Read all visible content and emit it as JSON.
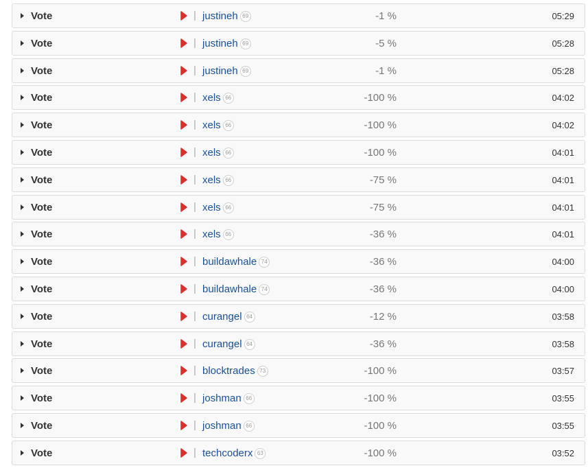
{
  "colors": {
    "link": "#1a5099",
    "play_icon": "#d9302c",
    "row_background": "#f9f9f9",
    "row_border": "#dcdcdc"
  },
  "icons": {
    "expand": "caret-right-icon",
    "media": "play-icon",
    "separator": "|"
  },
  "rows": [
    {
      "op": "Vote",
      "voter": "justineh",
      "rep": "69",
      "weight": "-1 %",
      "time": "05:29"
    },
    {
      "op": "Vote",
      "voter": "justineh",
      "rep": "69",
      "weight": "-5 %",
      "time": "05:28"
    },
    {
      "op": "Vote",
      "voter": "justineh",
      "rep": "69",
      "weight": "-1 %",
      "time": "05:28"
    },
    {
      "op": "Vote",
      "voter": "xels",
      "rep": "66",
      "weight": "-100 %",
      "time": "04:02"
    },
    {
      "op": "Vote",
      "voter": "xels",
      "rep": "66",
      "weight": "-100 %",
      "time": "04:02"
    },
    {
      "op": "Vote",
      "voter": "xels",
      "rep": "66",
      "weight": "-100 %",
      "time": "04:01"
    },
    {
      "op": "Vote",
      "voter": "xels",
      "rep": "66",
      "weight": "-75 %",
      "time": "04:01"
    },
    {
      "op": "Vote",
      "voter": "xels",
      "rep": "66",
      "weight": "-75 %",
      "time": "04:01"
    },
    {
      "op": "Vote",
      "voter": "xels",
      "rep": "66",
      "weight": "-36 %",
      "time": "04:01"
    },
    {
      "op": "Vote",
      "voter": "buildawhale",
      "rep": "74",
      "weight": "-36 %",
      "time": "04:00"
    },
    {
      "op": "Vote",
      "voter": "buildawhale",
      "rep": "74",
      "weight": "-36 %",
      "time": "04:00"
    },
    {
      "op": "Vote",
      "voter": "curangel",
      "rep": "64",
      "weight": "-12 %",
      "time": "03:58"
    },
    {
      "op": "Vote",
      "voter": "curangel",
      "rep": "64",
      "weight": "-36 %",
      "time": "03:58"
    },
    {
      "op": "Vote",
      "voter": "blocktrades",
      "rep": "73",
      "weight": "-100 %",
      "time": "03:57"
    },
    {
      "op": "Vote",
      "voter": "joshman",
      "rep": "66",
      "weight": "-100 %",
      "time": "03:55"
    },
    {
      "op": "Vote",
      "voter": "joshman",
      "rep": "66",
      "weight": "-100 %",
      "time": "03:55"
    },
    {
      "op": "Vote",
      "voter": "techcoderx",
      "rep": "63",
      "weight": "-100 %",
      "time": "03:52"
    }
  ]
}
